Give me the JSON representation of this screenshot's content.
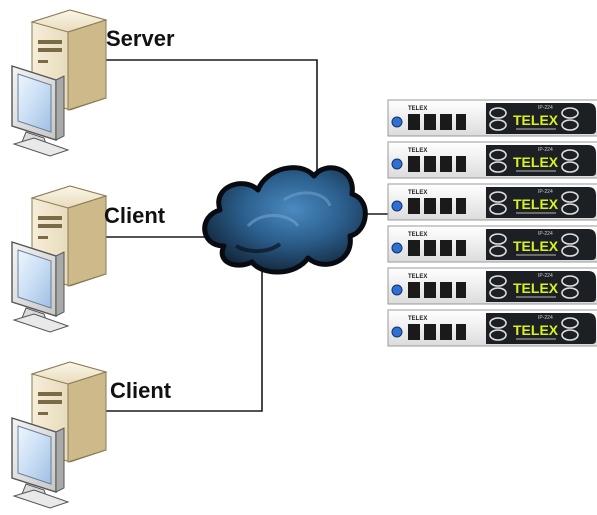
{
  "nodes": {
    "server": {
      "label": "Server",
      "icon": "server-computer-icon"
    },
    "client_1": {
      "label": "Client",
      "icon": "client-computer-icon"
    },
    "client_2": {
      "label": "Client",
      "icon": "client-computer-icon"
    }
  },
  "network": {
    "icon": "network-cloud-icon"
  },
  "devices": {
    "icon": "telex-ip224-rack-unit-icon",
    "brand": "TELEX",
    "model": "IP-224",
    "count": 6
  },
  "colors": {
    "link": "#1a1a1a",
    "cloud_dark": "#10161f",
    "cloud_light": "#3d7fb4",
    "device_face": "#1c1f24",
    "device_brand": "#d9f21f",
    "accent_blue": "#2f6fd1"
  }
}
